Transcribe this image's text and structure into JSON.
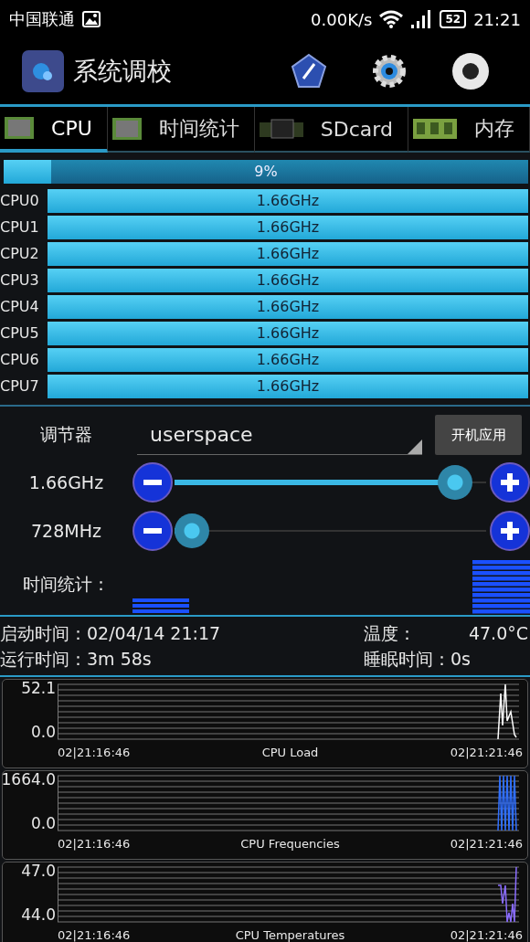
{
  "status_bar": {
    "carrier": "中国联通",
    "speed": "0.00K/s",
    "battery": "52",
    "time": "21:21"
  },
  "app_bar": {
    "title": "系统调校"
  },
  "tabs": [
    {
      "label": "CPU",
      "selected": true
    },
    {
      "label": "时间统计",
      "selected": false
    },
    {
      "label": "SDcard",
      "selected": false
    },
    {
      "label": "内存",
      "selected": false
    }
  ],
  "total": {
    "reading": "9%",
    "level": 0.09
  },
  "cpus": [
    {
      "name": "CPU0",
      "reading": "1.66GHz",
      "level": 1
    },
    {
      "name": "CPU1",
      "reading": "1.66GHz",
      "level": 1
    },
    {
      "name": "CPU2",
      "reading": "1.66GHz",
      "level": 1
    },
    {
      "name": "CPU3",
      "reading": "1.66GHz",
      "level": 1
    },
    {
      "name": "CPU4",
      "reading": "1.66GHz",
      "level": 1
    },
    {
      "name": "CPU5",
      "reading": "1.66GHz",
      "level": 1
    },
    {
      "name": "CPU6",
      "reading": "1.66GHz",
      "level": 1
    },
    {
      "name": "CPU7",
      "reading": "1.66GHz",
      "level": 1
    }
  ],
  "governor": {
    "label": "调节器",
    "value": "userspace",
    "button": "开机应用"
  },
  "sliders": [
    {
      "reading": "1.66GHz",
      "level": 0.95
    },
    {
      "reading": "728MHz",
      "level": 0
    }
  ],
  "time_stats": {
    "label": "时间统计："
  },
  "info": [
    {
      "label": "启动时间：",
      "value": "02/04/14 21:17"
    },
    {
      "label": "温度：",
      "value": "47.0°C"
    },
    {
      "label": "运行时间：",
      "value": "3m 58s"
    },
    {
      "label": "睡眠时间：",
      "value": "0s"
    }
  ],
  "charts": [
    {
      "title": "CPU Load",
      "ymax": "52.1",
      "ymin": "0.0",
      "x_start": "02|21:16:46",
      "x_end": "02|21:21:46",
      "color": "#ffffff"
    },
    {
      "title": "CPU Frequencies",
      "ymax": "1664.0",
      "ymin": "0.0",
      "x_start": "02|21:16:46",
      "x_end": "02|21:21:46",
      "color": "#2f6fff"
    },
    {
      "title": "CPU Temperatures",
      "ymax": "47.0",
      "ymin": "44.0",
      "x_start": "02|21:16:46",
      "x_end": "02|21:21:46",
      "color": "#8a6cff"
    }
  ]
}
